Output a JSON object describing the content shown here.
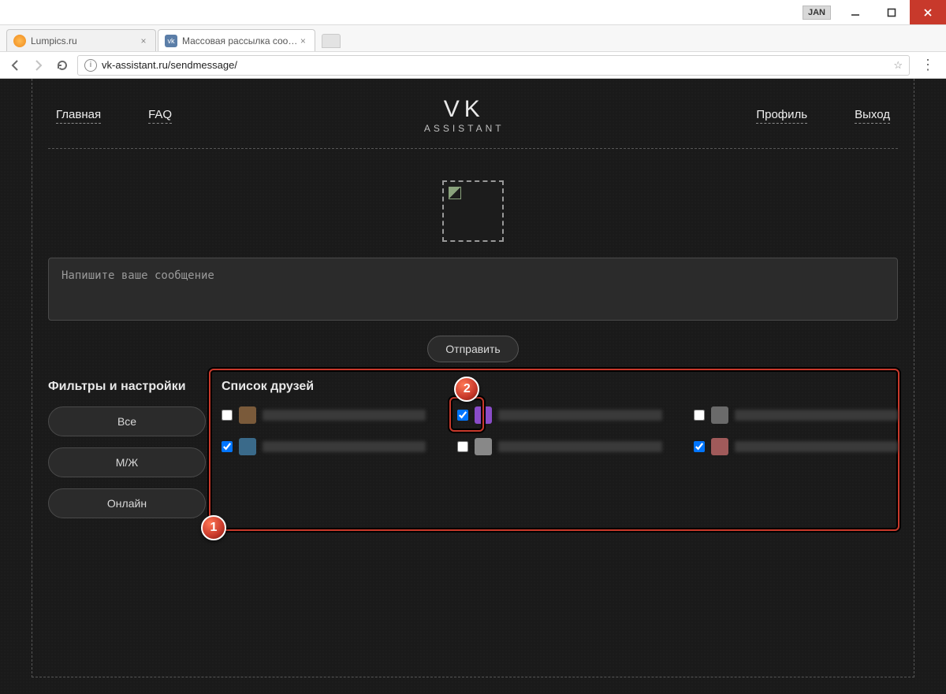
{
  "window": {
    "lang_badge": "JAN"
  },
  "tabs": [
    {
      "title": "Lumpics.ru",
      "favicon_color": "#f4a63a",
      "active": false
    },
    {
      "title": "Массовая рассылка соо…",
      "prefix": "vk",
      "active": true
    }
  ],
  "address_bar": {
    "url": "vk-assistant.ru/sendmessage/"
  },
  "nav": {
    "home": "Главная",
    "faq": "FAQ",
    "logo_big": "VK",
    "logo_sub": "ASSISTANT",
    "profile": "Профиль",
    "logout": "Выход"
  },
  "compose": {
    "placeholder": "Напишите ваше сообщение",
    "send": "Отправить"
  },
  "filters": {
    "heading": "Фильтры и настройки",
    "all": "Все",
    "gender": "М/Ж",
    "online": "Онлайн"
  },
  "friends": {
    "heading": "Список друзей",
    "items": [
      {
        "checked": false,
        "avatar_color": "#7a5a3a"
      },
      {
        "checked": true,
        "avatar_color": "#8a4cc8"
      },
      {
        "checked": false,
        "avatar_color": "#6a6a6a"
      },
      {
        "checked": true,
        "avatar_color": "#3a6a8a"
      },
      {
        "checked": false,
        "avatar_color": "#888888"
      },
      {
        "checked": true,
        "avatar_color": "#a05a5a"
      }
    ]
  },
  "annotations": {
    "badge1": "1",
    "badge2": "2"
  }
}
